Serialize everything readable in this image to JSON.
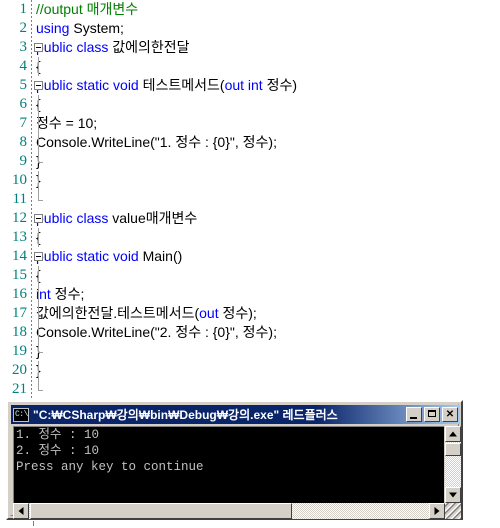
{
  "editor": {
    "name": "code-editor",
    "language": "C#",
    "line_number_color": "#008080",
    "keyword_color": "#0000FF",
    "comment_color": "#008000",
    "text_color": "#000000",
    "background": "#FFFFFF",
    "lines": [
      {
        "n": "1",
        "fold": "none",
        "segments": [
          {
            "t": "//output 매개변수",
            "c": "cmt"
          }
        ]
      },
      {
        "n": "2",
        "fold": "none",
        "segments": [
          {
            "t": "using",
            "c": "kw"
          },
          {
            "t": " System;",
            "c": "pln"
          }
        ]
      },
      {
        "n": "3",
        "fold": "box",
        "segments": [
          {
            "t": "public class",
            "c": "kw"
          },
          {
            "t": " 값에의한전달",
            "c": "pln"
          }
        ]
      },
      {
        "n": "4",
        "fold": "bar",
        "segments": [
          {
            "t": "{",
            "c": "pln"
          }
        ]
      },
      {
        "n": "5",
        "fold": "box2",
        "segments": [
          {
            "t": "  public static void",
            "c": "kw"
          },
          {
            "t": " 테스트메서드(",
            "c": "pln"
          },
          {
            "t": "out int",
            "c": "kw"
          },
          {
            "t": " 정수)",
            "c": "pln"
          }
        ]
      },
      {
        "n": "6",
        "fold": "bar",
        "segments": [
          {
            "t": "  {",
            "c": "pln"
          }
        ]
      },
      {
        "n": "7",
        "fold": "bar",
        "segments": [
          {
            "t": "    정수  = 10;",
            "c": "pln"
          }
        ]
      },
      {
        "n": "8",
        "fold": "bar",
        "segments": [
          {
            "t": "    Console.WriteLine(\"1. 정수 : {0}\", 정수);",
            "c": "pln"
          }
        ]
      },
      {
        "n": "9",
        "fold": "endin",
        "segments": [
          {
            "t": "  }",
            "c": "pln"
          }
        ]
      },
      {
        "n": "10",
        "fold": "bar",
        "segments": [
          {
            "t": "}",
            "c": "pln"
          }
        ]
      },
      {
        "n": "11",
        "fold": "end",
        "segments": []
      },
      {
        "n": "12",
        "fold": "box",
        "segments": [
          {
            "t": "public class",
            "c": "kw"
          },
          {
            "t": " value매개변수",
            "c": "pln"
          }
        ]
      },
      {
        "n": "13",
        "fold": "bar",
        "segments": [
          {
            "t": "{",
            "c": "pln"
          }
        ]
      },
      {
        "n": "14",
        "fold": "box2",
        "segments": [
          {
            "t": "  public static void",
            "c": "kw"
          },
          {
            "t": " Main()",
            "c": "pln"
          }
        ]
      },
      {
        "n": "15",
        "fold": "bar",
        "segments": [
          {
            "t": "  {",
            "c": "pln"
          }
        ]
      },
      {
        "n": "16",
        "fold": "bar",
        "segments": [
          {
            "t": "    ",
            "c": "pln"
          },
          {
            "t": "int",
            "c": "kw"
          },
          {
            "t": " 정수;",
            "c": "pln"
          }
        ]
      },
      {
        "n": "17",
        "fold": "bar",
        "segments": [
          {
            "t": "    값에의한전달.테스트메서드(",
            "c": "pln"
          },
          {
            "t": "out",
            "c": "kw"
          },
          {
            "t": " 정수);",
            "c": "pln"
          }
        ]
      },
      {
        "n": "18",
        "fold": "bar",
        "segments": [
          {
            "t": "    Console.WriteLine(\"2. 정수 : {0}\", 정수);",
            "c": "pln"
          }
        ]
      },
      {
        "n": "19",
        "fold": "endin",
        "segments": [
          {
            "t": "  }",
            "c": "pln"
          }
        ]
      },
      {
        "n": "20",
        "fold": "bar",
        "segments": [
          {
            "t": "}",
            "c": "pln"
          }
        ]
      },
      {
        "n": "21",
        "fold": "end",
        "segments": []
      }
    ]
  },
  "console_window": {
    "title": "\"C:₩CSharp₩강의₩bin₩Debug₩강의.exe\" 레드플러스",
    "icon": "console-window-icon",
    "titlebar_color": "#0A246A",
    "titlebar_text_color": "#FFFFFF",
    "caption_buttons": [
      {
        "name": "minimize",
        "label": ""
      },
      {
        "name": "maximize",
        "label": ""
      },
      {
        "name": "close",
        "label": "✕"
      }
    ],
    "screen_background": "#000000",
    "screen_text_color": "#C0C0C0",
    "output_lines": [
      "1. 정수 : 10",
      "2. 정수 : 10",
      "Press any key to continue"
    ],
    "scrollbars": {
      "vertical": {
        "up_label": "▲",
        "down_label": "▼"
      },
      "horizontal": {
        "left_label": "◀",
        "right_label": "▶"
      }
    }
  }
}
